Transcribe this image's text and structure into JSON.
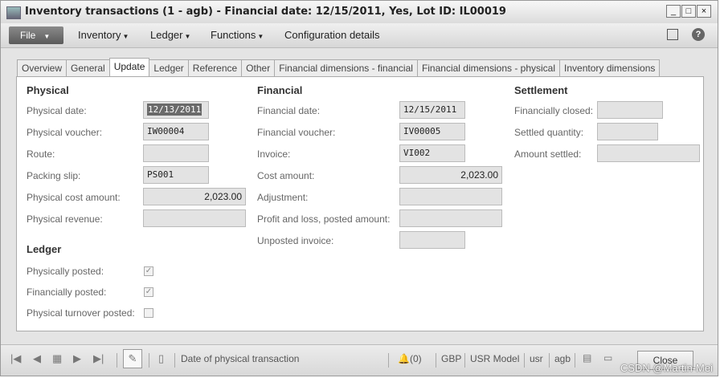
{
  "window": {
    "title": "Inventory transactions (1 - agb) - Financial date: 12/15/2011, Yes, Lot ID: IL00019",
    "minimize": "_",
    "maximize": "□",
    "close": "×"
  },
  "menu": {
    "file": "File",
    "items": [
      "Inventory",
      "Ledger",
      "Functions",
      "Configuration details"
    ],
    "help": "?"
  },
  "tabs": [
    "Overview",
    "General",
    "Update",
    "Ledger",
    "Reference",
    "Other",
    "Financial dimensions - financial",
    "Financial dimensions - physical",
    "Inventory dimensions"
  ],
  "active_tab": "Update",
  "physical": {
    "title": "Physical",
    "physical_date_label": "Physical date:",
    "physical_date": "12/13/2011",
    "physical_voucher_label": "Physical voucher:",
    "physical_voucher": "IW00004",
    "route_label": "Route:",
    "route": "",
    "packing_slip_label": "Packing slip:",
    "packing_slip": "PS001",
    "physical_cost_amount_label": "Physical cost amount:",
    "physical_cost_amount": "2,023.00",
    "physical_revenue_label": "Physical revenue:",
    "physical_revenue": ""
  },
  "ledger": {
    "title": "Ledger",
    "physically_posted_label": "Physically posted:",
    "physically_posted": true,
    "financially_posted_label": "Financially posted:",
    "financially_posted": true,
    "physical_turnover_posted_label": "Physical turnover posted:",
    "physical_turnover_posted": false
  },
  "financial": {
    "title": "Financial",
    "financial_date_label": "Financial date:",
    "financial_date": "12/15/2011",
    "financial_voucher_label": "Financial voucher:",
    "financial_voucher": "IV00005",
    "invoice_label": "Invoice:",
    "invoice": "VI002",
    "cost_amount_label": "Cost amount:",
    "cost_amount": "2,023.00",
    "adjustment_label": "Adjustment:",
    "adjustment": "",
    "profit_loss_label": "Profit and loss, posted amount:",
    "profit_loss": "",
    "unposted_invoice_label": "Unposted invoice:",
    "unposted_invoice": ""
  },
  "settlement": {
    "title": "Settlement",
    "financially_closed_label": "Financially closed:",
    "financially_closed": "",
    "settled_quantity_label": "Settled quantity:",
    "settled_quantity": "",
    "amount_settled_label": "Amount settled:",
    "amount_settled": ""
  },
  "statusbar": {
    "help_text": "Date of physical transaction",
    "notifications": "(0)",
    "currency": "GBP",
    "model": "USR Model",
    "layer": "usr",
    "company": "agb",
    "close": "Close"
  },
  "watermark": "CSDN @Martin-Mei"
}
